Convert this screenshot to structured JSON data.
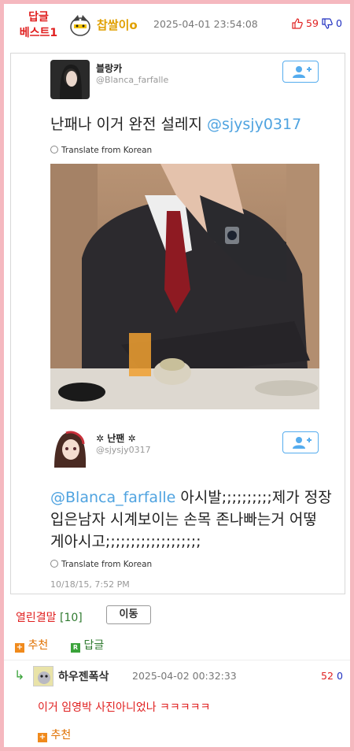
{
  "header": {
    "badge_line1": "답글",
    "badge_line2": "베스트1",
    "author": "찹쌀이o",
    "timestamp": "2025-04-01 23:54:08",
    "upvotes": "59",
    "downvotes": "0"
  },
  "tweet1": {
    "name": "블랑카",
    "handle": "@Blanca_farfalle",
    "text": "난패나 이거 완전 설레지 ",
    "mention": "@sjysjy0317",
    "translate": "Translate from Korean"
  },
  "tweet2": {
    "name": "✲ 난팬 ✲",
    "handle": "@sjysjy0317",
    "mention": "@Blanca_farfalle",
    "text_line1_rest": " 아시발;;;;;;;;;;제가 정장",
    "text_line2": "입은남자 시계보이는 손목 존나빠는거 어떻",
    "text_line3": "게아시고;;;;;;;;;;;;;;;;;;;",
    "translate": "Translate from Korean",
    "date": "10/18/15, 7:52 PM"
  },
  "post_actions": {
    "board_name": "열린결말",
    "board_count": "[10]",
    "move_label": "이동",
    "recommend_label": "추천",
    "reply_label": "답글"
  },
  "comment": {
    "arrow": "↳",
    "author": "하우젠폭삭",
    "timestamp": "2025-04-02 00:32:33",
    "upvotes": "52",
    "downvotes": "0",
    "text": "이거 임영박 사진아니었나 ㅋㅋㅋㅋㅋ",
    "recommend_label": "추천"
  },
  "colors": {
    "border_pink": "#f5b8bf",
    "best_red": "#e02020",
    "author_gold": "#e0a000",
    "twitter_blue": "#4fa3e0",
    "green": "#3aa33a",
    "orange": "#f08a1c"
  }
}
